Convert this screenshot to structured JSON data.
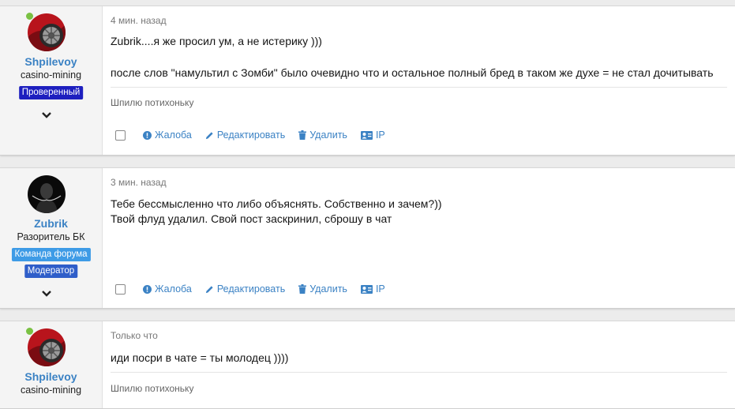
{
  "posts": [
    {
      "user": {
        "name": "Shpilevoy",
        "title": "casino-mining",
        "online": true,
        "badges": [
          {
            "label": "Проверенный",
            "color": "#1d1fbf"
          }
        ]
      },
      "time": "4 мин. назад",
      "lines": [
        "Zubrik....я же просил ум, а не истерику )))",
        "после слов \"намультил с Зомби\" было очевидно что и остальное полный бред в таком же духе = не стал дочитывать"
      ],
      "signature": "Шпилю потихоньку"
    },
    {
      "user": {
        "name": "Zubrik",
        "title": "Разоритель БК",
        "online": false,
        "badges": [
          {
            "label": "Команда форума",
            "color": "#3e9be6"
          },
          {
            "label": "Модератор",
            "color": "#2f5ec9"
          }
        ]
      },
      "time": "3 мин. назад",
      "lines": [
        "Тебе бессмысленно что либо объяснять. Собственно и зачем?))",
        "Твой флуд удалил. Свой пост заскринил, сброшу в чат"
      ],
      "signature": ""
    },
    {
      "user": {
        "name": "Shpilevoy",
        "title": "casino-mining",
        "online": true,
        "badges": []
      },
      "time": "Только что",
      "lines": [
        "иди посри в чате = ты молодец ))))"
      ],
      "signature": "Шпилю потихоньку"
    }
  ],
  "actions": {
    "report": "Жалоба",
    "edit": "Редактировать",
    "delete": "Удалить",
    "ip": "IP"
  },
  "colors": {
    "link": "#3b82c4",
    "online": "#7ac143"
  }
}
